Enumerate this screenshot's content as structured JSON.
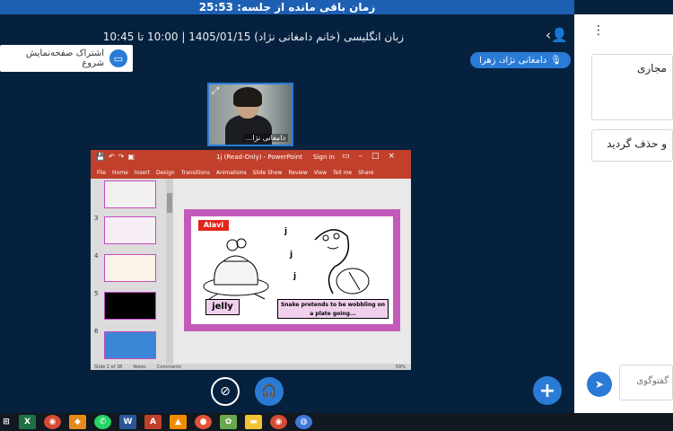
{
  "timer": {
    "text": "زمان باقی مانده از جلسه: 25:53"
  },
  "meeting": {
    "title": "زبان انگلیسی (خانم دامغانی نژاد) 1405/01/15 | 10:00 تا 10:45"
  },
  "share": {
    "label": "اشتراک صفحه‌نمایش شروع"
  },
  "presenter": {
    "name": "دامغانی نژاد، زهرا"
  },
  "webcam": {
    "name": "دامغانی نژا..."
  },
  "right_panel": {
    "card1": "مجاری",
    "card2": "و حذف گردید",
    "input_placeholder": "گفتوگوی"
  },
  "powerpoint": {
    "window_title": "(Read-Only) - PowerPoint",
    "file_name": "1j",
    "sign_in": "Sign in",
    "menu": [
      "File",
      "Home",
      "Insert",
      "Design",
      "Transitions",
      "Animations",
      "Slide Show",
      "Review",
      "View",
      "Tell me",
      "Share"
    ],
    "thumb_numbers": [
      "3",
      "4",
      "5",
      "6"
    ],
    "status": {
      "slide": "Slide 2 of 38",
      "notes": "Notes",
      "comments": "Comments",
      "zoom": "59%"
    },
    "slide": {
      "tag": "Alavi",
      "word": "jelly",
      "caption": "Snake pretends to be wobbling on a plate going...",
      "letters": [
        "j",
        "j",
        "j"
      ]
    }
  },
  "colors": {
    "background": "#06213e",
    "timer_bar": "#1d5fb2",
    "accent": "#2a7bd6",
    "ppt_red": "#c1402b",
    "slide_border": "#c35ab9"
  },
  "icons": {
    "user": "user-icon",
    "share": "screen-share-icon",
    "mic": "microphone-icon",
    "expand": "expand-icon",
    "camera_off": "camera-off-icon",
    "headphones": "headphones-icon",
    "plus": "plus-icon",
    "send": "send-icon",
    "kebab": "kebab-menu-icon"
  }
}
